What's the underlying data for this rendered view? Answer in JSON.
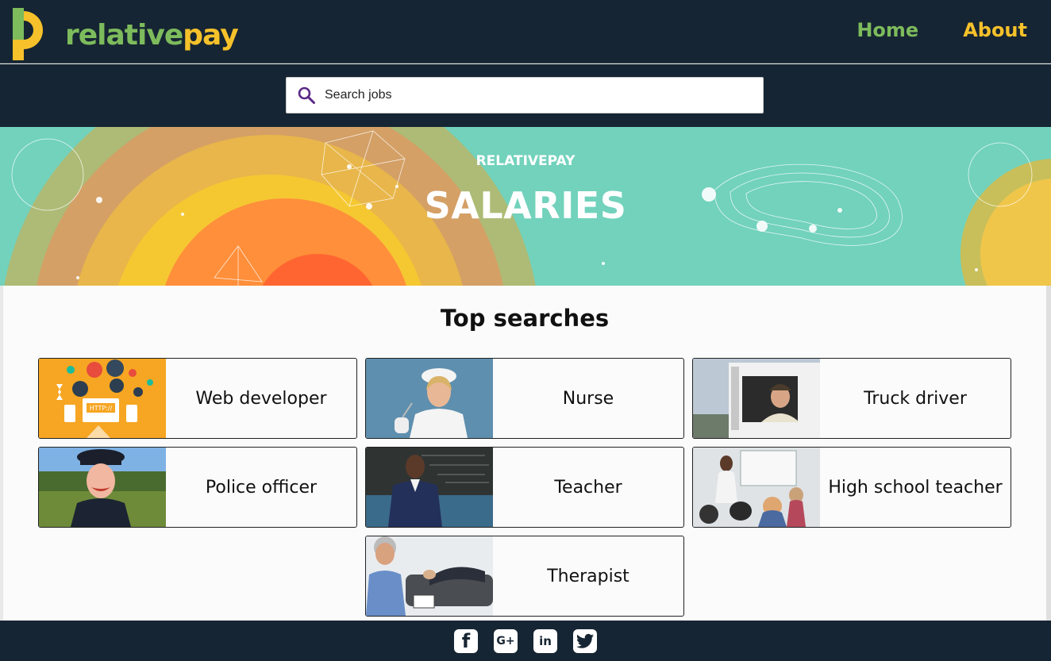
{
  "header": {
    "logo_text_1": "relative",
    "logo_text_2": "pay",
    "nav": {
      "home": "Home",
      "about": "About"
    }
  },
  "search": {
    "placeholder": "Search jobs",
    "icon": "search-icon"
  },
  "hero": {
    "subtitle": "RELATIVEPAY",
    "title": "SALARIES"
  },
  "top_searches": {
    "title": "Top searches",
    "items": [
      {
        "label": "Web developer"
      },
      {
        "label": "Nurse"
      },
      {
        "label": "Truck driver"
      },
      {
        "label": "Police officer"
      },
      {
        "label": "Teacher"
      },
      {
        "label": "High school teacher"
      },
      {
        "label": "Therapist"
      }
    ]
  },
  "footer": {
    "social": [
      {
        "icon": "facebook-icon",
        "glyph": "f"
      },
      {
        "icon": "google-plus-icon",
        "glyph": "G+"
      },
      {
        "icon": "linkedin-icon",
        "glyph": "in"
      },
      {
        "icon": "twitter-icon",
        "glyph": ""
      }
    ]
  },
  "colors": {
    "navy": "#162533",
    "green": "#7dbb5c",
    "yellow": "#f6c12a",
    "teal": "#72d2bc"
  }
}
